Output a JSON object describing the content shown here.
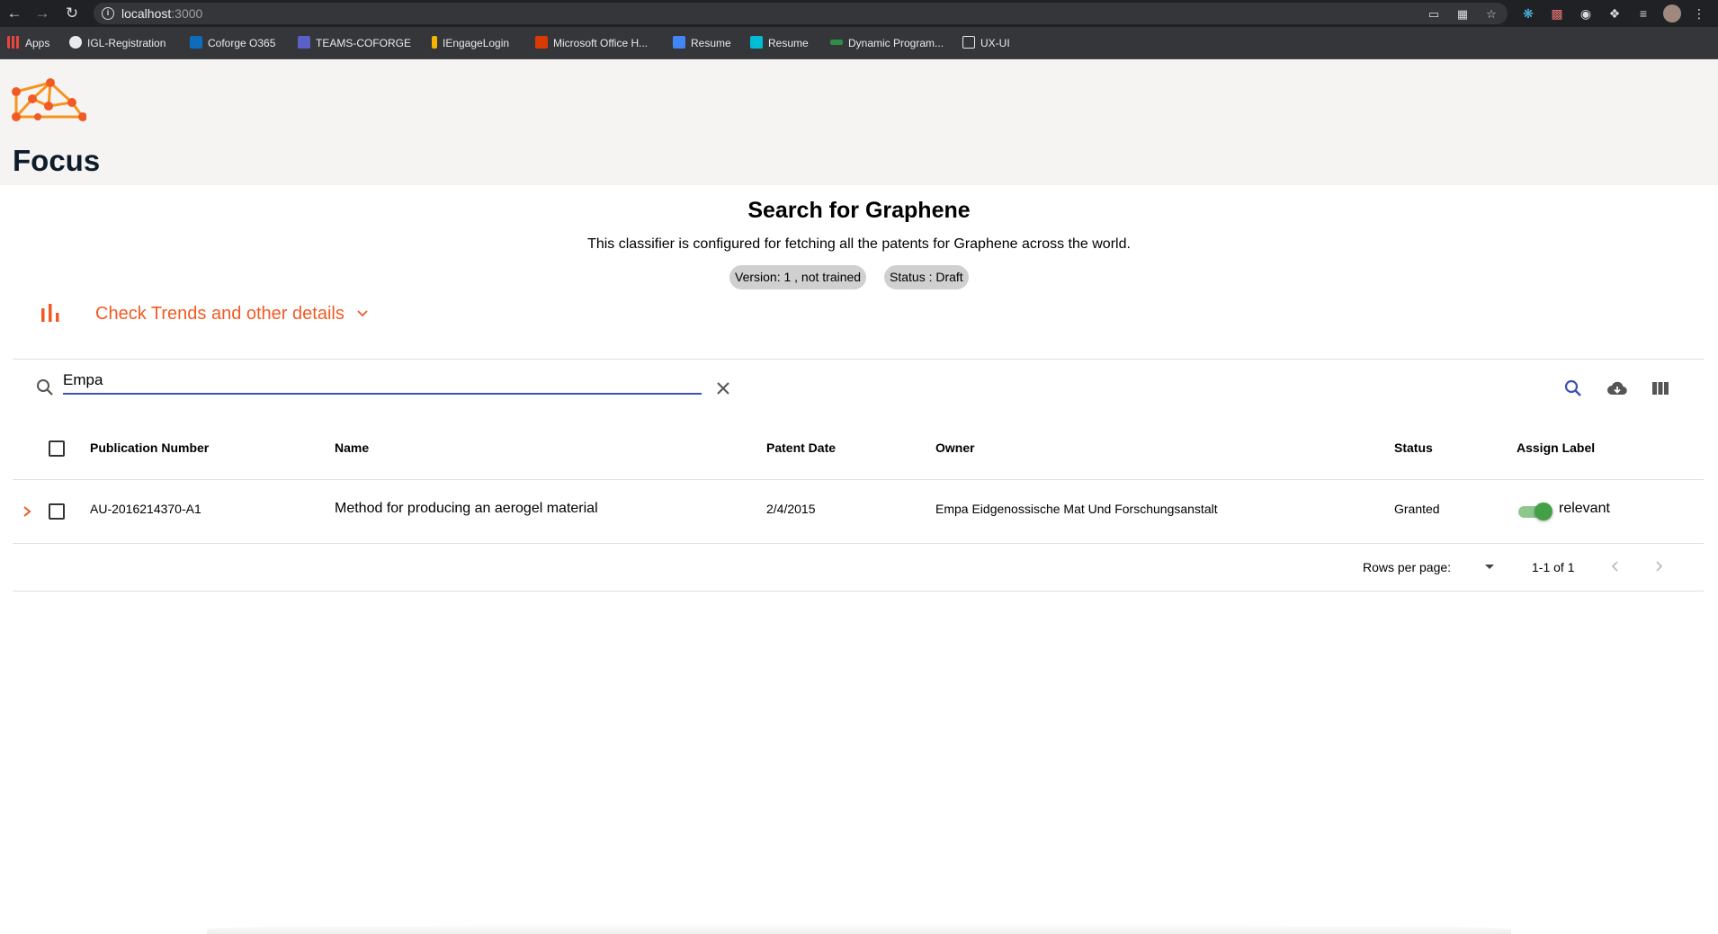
{
  "browser": {
    "url_host": "localhost",
    "url_port": ":3000",
    "bookmarks": [
      {
        "label": "Apps",
        "icon": "apps-grid-icon",
        "color": "#e8453c"
      },
      {
        "label": "IGL-Registration",
        "icon": "globe-icon",
        "color": "#e8eaed"
      },
      {
        "label": "Coforge O365",
        "icon": "outlook-icon",
        "color": "#0f6cbd"
      },
      {
        "label": "TEAMS-COFORGE",
        "icon": "teams-icon",
        "color": "#5b5fc7"
      },
      {
        "label": "IEngageLogin",
        "icon": "iengage-icon",
        "color": "#f4b400"
      },
      {
        "label": "Microsoft Office H...",
        "icon": "office-icon",
        "color": "#d83b01"
      },
      {
        "label": "Resume",
        "icon": "resume-doc-icon",
        "color": "#4285f4"
      },
      {
        "label": "Resume",
        "icon": "m-logo-icon",
        "color": "#00bcd4"
      },
      {
        "label": "Dynamic Program...",
        "icon": "gfg-icon",
        "color": "#2f8d46"
      },
      {
        "label": "UX-UI",
        "icon": "folder-icon",
        "color": "#e8eaed"
      }
    ]
  },
  "app": {
    "title": "Focus",
    "logo": "graphene-network-logo",
    "brand_color": "#f15a24"
  },
  "classifier": {
    "title": "Search for Graphene",
    "description": "This classifier is configured for fetching all the patents for Graphene across the world.",
    "version_chip": "Version: 1 , not trained",
    "status_chip": "Status : Draft"
  },
  "trends": {
    "label": "Check Trends and other details",
    "icon": "bar-chart-icon"
  },
  "search": {
    "value": "Empa"
  },
  "toolbar": {
    "icons": [
      "search-icon",
      "cloud-download-icon",
      "view-columns-icon"
    ]
  },
  "table": {
    "columns": [
      "Publication Number",
      "Name",
      "Patent Date",
      "Owner",
      "Status",
      "Assign Label"
    ],
    "rows": [
      {
        "publication_number": "AU-2016214370-A1",
        "name": "Method for producing an aerogel material",
        "patent_date": "2/4/2015",
        "owner": "Empa Eidgenossische Mat Und Forschungsanstalt",
        "status": "Granted",
        "label": "relevant",
        "label_on": true
      }
    ]
  },
  "pagination": {
    "rows_per_page_label": "Rows per page:",
    "range": "1-1 of 1"
  }
}
